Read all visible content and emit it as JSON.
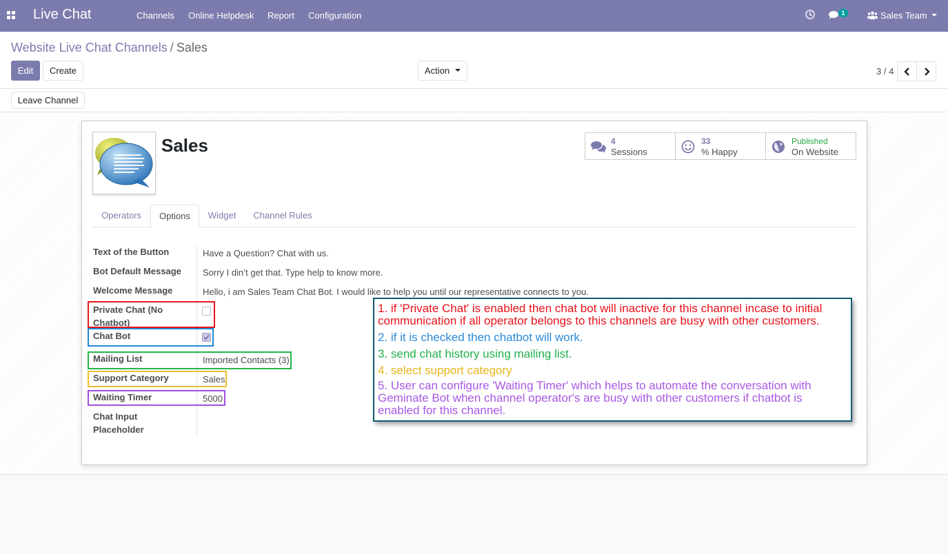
{
  "navbar": {
    "app_title": "Live Chat",
    "menu": [
      "Channels",
      "Online Helpdesk",
      "Report",
      "Configuration"
    ],
    "messages_badge": "1",
    "user_label": "Sales Team",
    "bg_color": "#7c7bad"
  },
  "control_panel": {
    "breadcrumb_parent": "Website Live Chat Channels",
    "breadcrumb_separator": "/",
    "breadcrumb_current": "Sales",
    "edit_label": "Edit",
    "create_label": "Create",
    "action_label": "Action",
    "pager_value": "3 / 4"
  },
  "statusbar": {
    "leave_channel_label": "Leave Channel"
  },
  "record": {
    "name": "Sales",
    "stats": {
      "sessions_value": "4",
      "sessions_label": "Sessions",
      "happy_value": "33",
      "happy_label": "% Happy",
      "published_value": "Published",
      "published_label": "On Website"
    }
  },
  "tabs": [
    "Operators",
    "Options",
    "Widget",
    "Channel Rules"
  ],
  "active_tab": "Options",
  "fields": {
    "button_text": {
      "label": "Text of the Button",
      "value": "Have a Question? Chat with us."
    },
    "bot_default": {
      "label": "Bot Default Message",
      "value": "Sorry I din’t get that. Type help to know more."
    },
    "welcome": {
      "label": "Welcome Message",
      "value": "Hello, i am Sales Team Chat Bot. I would like to help you until our representative connects to you."
    },
    "private_chat": {
      "label_line1": "Private Chat (No",
      "label_line2": "Chatbot)",
      "checked": false
    },
    "chat_bot": {
      "label": "Chat Bot",
      "checked": true
    },
    "mailing_list": {
      "label": "Mailing List",
      "value": "Imported Contacts (3)"
    },
    "support_category": {
      "label": "Support Category",
      "value": "Sales"
    },
    "waiting_timer": {
      "label": "Waiting Timer",
      "value": "5000"
    },
    "chat_input": {
      "label_line1": "Chat Input",
      "label_line2": "Placeholder"
    }
  },
  "annotation": {
    "note1_line1": "1. if 'Private Chat' is enabled then chat bot will inactive for this channel incase to initial",
    "note1_line2": "communication if all operator belongs to this channels are busy with other customers.",
    "note2": "2. if it is checked then chatbot will work.",
    "note3": "3. send chat history using mailing list.",
    "note4": "4. select support category",
    "note5_line1": "5. User can configure 'Waiting Timer' which helps to automate the conversation with",
    "note5_line2": "Geminate Bot when channel operator's are busy with other customers if chatbot is",
    "note5_line3": "enabled for this channel.",
    "colors": {
      "red": "#e8121a",
      "blue": "#2b8ad9",
      "green": "#21b04b",
      "yellow": "#e7b41b",
      "purple": "#a858e5"
    }
  }
}
